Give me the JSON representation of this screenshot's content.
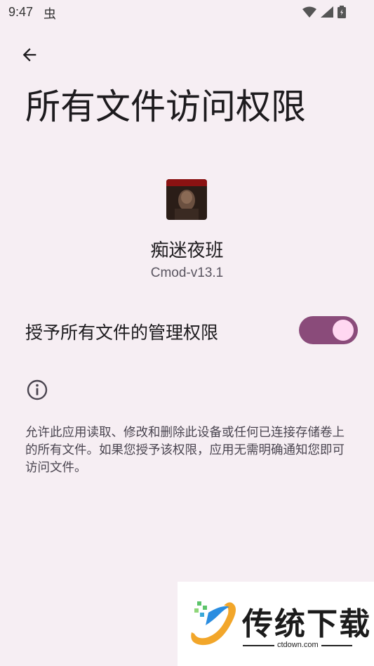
{
  "status_bar": {
    "time": "9:47",
    "debug_icon": "bug-icon",
    "icons": [
      "wifi-icon",
      "signal-icon",
      "battery-icon"
    ]
  },
  "header": {
    "back_icon": "arrow-back-icon",
    "title": "所有文件访问权限"
  },
  "app": {
    "name": "痴迷夜班",
    "version": "Cmod-v13.1"
  },
  "setting": {
    "label": "授予所有文件的管理权限",
    "enabled": true,
    "accent": "#8a4b7a"
  },
  "info": {
    "icon": "info-icon",
    "description": "允许此应用读取、修改和删除此设备或任何已连接存储卷上的所有文件。如果您授予该权限，应用无需明确通知您即可访问文件。"
  },
  "watermark": {
    "brand": "传统下载",
    "url": "ctdown.com"
  }
}
